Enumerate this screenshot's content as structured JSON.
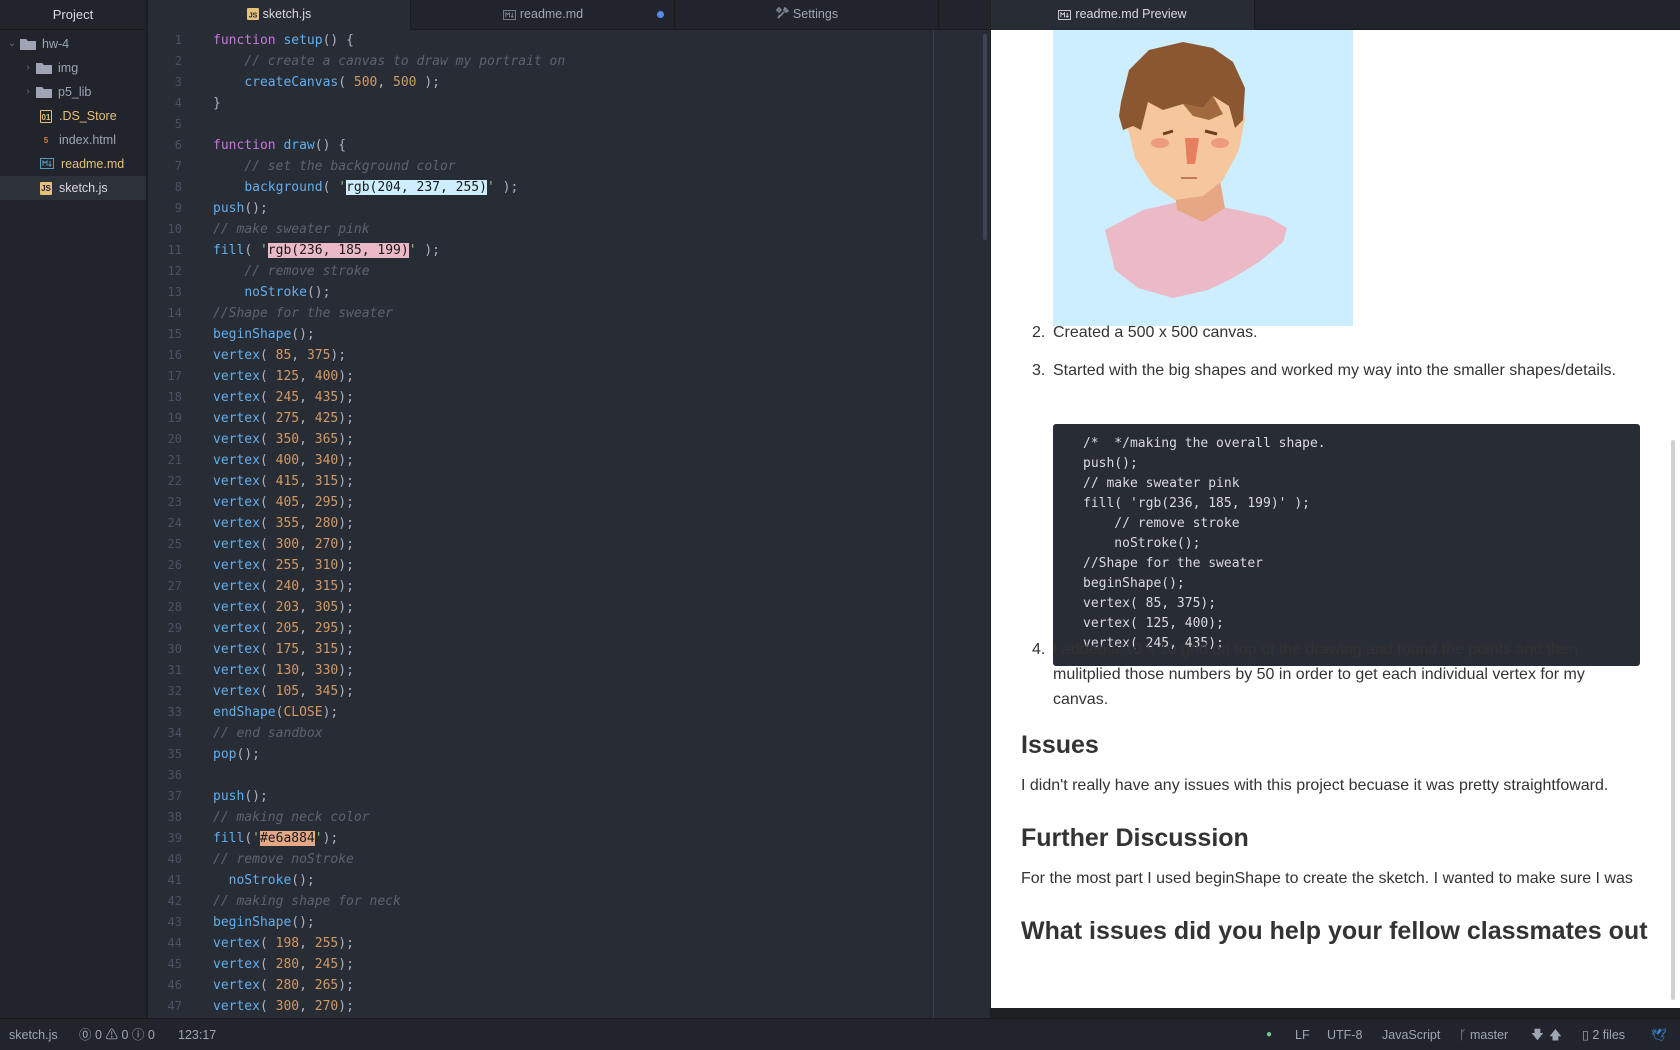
{
  "sidebar": {
    "title": "Project",
    "items": [
      {
        "label": "hw-4",
        "kind": "root"
      },
      {
        "label": "img",
        "kind": "folder"
      },
      {
        "label": "p5_lib",
        "kind": "folder"
      },
      {
        "label": ".DS_Store",
        "kind": "file",
        "icon": "binary-file-icon"
      },
      {
        "label": "index.html",
        "kind": "file",
        "icon": "html-file-icon"
      },
      {
        "label": "readme.md",
        "kind": "file",
        "icon": "markdown-file-icon"
      },
      {
        "label": "sketch.js",
        "kind": "file",
        "icon": "js-file-icon"
      }
    ]
  },
  "tabs": [
    {
      "label": "sketch.js",
      "active": true
    },
    {
      "label": "readme.md",
      "modified": true
    },
    {
      "label": "Settings"
    }
  ],
  "preview_tab": {
    "label": "readme.md Preview"
  },
  "editor": {
    "lines": [
      [
        [
          "kw",
          "function "
        ],
        [
          "fn",
          "setup"
        ],
        [
          "",
          "() {"
        ]
      ],
      [
        [
          "",
          "    "
        ],
        [
          "cm",
          "// create a canvas to draw my portrait on"
        ]
      ],
      [
        [
          "",
          "    "
        ],
        [
          "fn",
          "createCanvas"
        ],
        [
          "",
          "( "
        ],
        [
          "num",
          "500"
        ],
        [
          "",
          ", "
        ],
        [
          "num",
          "500"
        ],
        [
          "",
          " );"
        ]
      ],
      [
        [
          "",
          "}"
        ]
      ],
      [],
      [
        [
          "kw",
          "function "
        ],
        [
          "fn",
          "draw"
        ],
        [
          "",
          "() {"
        ]
      ],
      [
        [
          "",
          "    "
        ],
        [
          "cm",
          "// set the background color"
        ]
      ],
      [
        [
          "",
          "    "
        ],
        [
          "fn",
          "background"
        ],
        [
          "",
          "( "
        ],
        [
          "str",
          "'"
        ],
        [
          "sw-blue",
          "rgb(204, 237, 255)"
        ],
        [
          "str",
          "'"
        ],
        [
          "",
          " );"
        ]
      ],
      [
        [
          "fn",
          "push"
        ],
        [
          "",
          "();"
        ]
      ],
      [
        [
          "cm",
          "// make sweater pink"
        ]
      ],
      [
        [
          "fn",
          "fill"
        ],
        [
          "",
          "( "
        ],
        [
          "str",
          "'"
        ],
        [
          "sw-pink",
          "rgb(236, 185, 199)"
        ],
        [
          "str",
          "'"
        ],
        [
          "",
          " );"
        ]
      ],
      [
        [
          "",
          "    "
        ],
        [
          "cm",
          "// remove stroke"
        ]
      ],
      [
        [
          "",
          "    "
        ],
        [
          "fn",
          "noStroke"
        ],
        [
          "",
          "();"
        ]
      ],
      [
        [
          "cm",
          "//Shape for the sweater"
        ]
      ],
      [
        [
          "fn",
          "beginShape"
        ],
        [
          "",
          "();"
        ]
      ],
      [
        [
          "fn",
          "vertex"
        ],
        [
          "",
          "( "
        ],
        [
          "num",
          "85"
        ],
        [
          "",
          ", "
        ],
        [
          "num",
          "375"
        ],
        [
          "",
          ");"
        ]
      ],
      [
        [
          "fn",
          "vertex"
        ],
        [
          "",
          "( "
        ],
        [
          "num",
          "125"
        ],
        [
          "",
          ", "
        ],
        [
          "num",
          "400"
        ],
        [
          "",
          ");"
        ]
      ],
      [
        [
          "fn",
          "vertex"
        ],
        [
          "",
          "( "
        ],
        [
          "num",
          "245"
        ],
        [
          "",
          ", "
        ],
        [
          "num",
          "435"
        ],
        [
          "",
          ");"
        ]
      ],
      [
        [
          "fn",
          "vertex"
        ],
        [
          "",
          "( "
        ],
        [
          "num",
          "275"
        ],
        [
          "",
          ", "
        ],
        [
          "num",
          "425"
        ],
        [
          "",
          ");"
        ]
      ],
      [
        [
          "fn",
          "vertex"
        ],
        [
          "",
          "( "
        ],
        [
          "num",
          "350"
        ],
        [
          "",
          ", "
        ],
        [
          "num",
          "365"
        ],
        [
          "",
          ");"
        ]
      ],
      [
        [
          "fn",
          "vertex"
        ],
        [
          "",
          "( "
        ],
        [
          "num",
          "400"
        ],
        [
          "",
          ", "
        ],
        [
          "num",
          "340"
        ],
        [
          "",
          ");"
        ]
      ],
      [
        [
          "fn",
          "vertex"
        ],
        [
          "",
          "( "
        ],
        [
          "num",
          "415"
        ],
        [
          "",
          ", "
        ],
        [
          "num",
          "315"
        ],
        [
          "",
          ");"
        ]
      ],
      [
        [
          "fn",
          "vertex"
        ],
        [
          "",
          "( "
        ],
        [
          "num",
          "405"
        ],
        [
          "",
          ", "
        ],
        [
          "num",
          "295"
        ],
        [
          "",
          ");"
        ]
      ],
      [
        [
          "fn",
          "vertex"
        ],
        [
          "",
          "( "
        ],
        [
          "num",
          "355"
        ],
        [
          "",
          ", "
        ],
        [
          "num",
          "280"
        ],
        [
          "",
          ");"
        ]
      ],
      [
        [
          "fn",
          "vertex"
        ],
        [
          "",
          "( "
        ],
        [
          "num",
          "300"
        ],
        [
          "",
          ", "
        ],
        [
          "num",
          "270"
        ],
        [
          "",
          ");"
        ]
      ],
      [
        [
          "fn",
          "vertex"
        ],
        [
          "",
          "( "
        ],
        [
          "num",
          "255"
        ],
        [
          "",
          ", "
        ],
        [
          "num",
          "310"
        ],
        [
          "",
          ");"
        ]
      ],
      [
        [
          "fn",
          "vertex"
        ],
        [
          "",
          "( "
        ],
        [
          "num",
          "240"
        ],
        [
          "",
          ", "
        ],
        [
          "num",
          "315"
        ],
        [
          "",
          ");"
        ]
      ],
      [
        [
          "fn",
          "vertex"
        ],
        [
          "",
          "( "
        ],
        [
          "num",
          "203"
        ],
        [
          "",
          ", "
        ],
        [
          "num",
          "305"
        ],
        [
          "",
          ");"
        ]
      ],
      [
        [
          "fn",
          "vertex"
        ],
        [
          "",
          "( "
        ],
        [
          "num",
          "205"
        ],
        [
          "",
          ", "
        ],
        [
          "num",
          "295"
        ],
        [
          "",
          ");"
        ]
      ],
      [
        [
          "fn",
          "vertex"
        ],
        [
          "",
          "( "
        ],
        [
          "num",
          "175"
        ],
        [
          "",
          ", "
        ],
        [
          "num",
          "315"
        ],
        [
          "",
          ");"
        ]
      ],
      [
        [
          "fn",
          "vertex"
        ],
        [
          "",
          "( "
        ],
        [
          "num",
          "130"
        ],
        [
          "",
          ", "
        ],
        [
          "num",
          "330"
        ],
        [
          "",
          ");"
        ]
      ],
      [
        [
          "fn",
          "vertex"
        ],
        [
          "",
          "( "
        ],
        [
          "num",
          "105"
        ],
        [
          "",
          ", "
        ],
        [
          "num",
          "345"
        ],
        [
          "",
          ");"
        ]
      ],
      [
        [
          "fn",
          "endShape"
        ],
        [
          "",
          "("
        ],
        [
          "num",
          "CLOSE"
        ],
        [
          "",
          ");"
        ]
      ],
      [
        [
          "cm",
          "// end sandbox"
        ]
      ],
      [
        [
          "fn",
          "pop"
        ],
        [
          "",
          "();"
        ]
      ],
      [],
      [
        [
          "fn",
          "push"
        ],
        [
          "",
          "();"
        ]
      ],
      [
        [
          "cm",
          "// making neck color"
        ]
      ],
      [
        [
          "fn",
          "fill"
        ],
        [
          "",
          "("
        ],
        [
          "str",
          "'"
        ],
        [
          "sw-tan",
          "#e6a884"
        ],
        [
          "str",
          "'"
        ],
        [
          "",
          ");"
        ]
      ],
      [
        [
          "cm",
          "// remove noStroke"
        ]
      ],
      [
        [
          "",
          "  "
        ],
        [
          "fn",
          "noStroke"
        ],
        [
          "",
          "();"
        ]
      ],
      [
        [
          "cm",
          "// making shape for neck"
        ]
      ],
      [
        [
          "fn",
          "beginShape"
        ],
        [
          "",
          "();"
        ]
      ],
      [
        [
          "fn",
          "vertex"
        ],
        [
          "",
          "( "
        ],
        [
          "num",
          "198"
        ],
        [
          "",
          ", "
        ],
        [
          "num",
          "255"
        ],
        [
          "",
          ");"
        ]
      ],
      [
        [
          "fn",
          "vertex"
        ],
        [
          "",
          "( "
        ],
        [
          "num",
          "280"
        ],
        [
          "",
          ", "
        ],
        [
          "num",
          "245"
        ],
        [
          "",
          ");"
        ]
      ],
      [
        [
          "fn",
          "vertex"
        ],
        [
          "",
          "( "
        ],
        [
          "num",
          "280"
        ],
        [
          "",
          ", "
        ],
        [
          "num",
          "265"
        ],
        [
          "",
          ");"
        ]
      ],
      [
        [
          "fn",
          "vertex"
        ],
        [
          "",
          "( "
        ],
        [
          "num",
          "300"
        ],
        [
          "",
          ", "
        ],
        [
          "num",
          "270"
        ],
        [
          "",
          ");"
        ]
      ]
    ]
  },
  "preview": {
    "item2_num": "2.",
    "item2": "Created a 500 x 500 canvas.",
    "item3_num": "3.",
    "item3": "Started with the big shapes and worked my way into the smaller shapes/details.",
    "code_lines": [
      "/*  */making the overall shape.",
      "push();",
      "// make sweater pink",
      "fill( 'rgb(236, 185, 199)' );",
      "    // remove stroke",
      "    noStroke();",
      "//Shape for the sweater",
      "beginShape();",
      "vertex( 85, 375);",
      "vertex( 125, 400);",
      "vertex( 245, 435);"
    ],
    "item4_num": "4.",
    "item4_lines": [
      "I added a 10 x 10 grid on top of the drawing and found the points and then",
      "mulitplied those numbers by 50 in order to get each individual vertex for my",
      "canvas."
    ],
    "h_issues": "Issues",
    "p_issues": "I didn't really have any issues with this project becuase it was pretty straightfoward.",
    "h_further": "Further Discussion",
    "p_further": "For the most part I used beginShape to create the sketch. I wanted to make sure I was",
    "h_help": "What issues did you help your fellow classmates out"
  },
  "status": {
    "file": "sketch.js",
    "errors": "0",
    "warnings": "0",
    "infos": "0",
    "cursor": "123:17",
    "line_ending": "LF",
    "encoding": "UTF-8",
    "grammar": "JavaScript",
    "branch": "master",
    "files": "2 files"
  },
  "colors": {
    "bg_blue": "#cceeff",
    "sweater_pink": "#ecb9c7",
    "neck_tan": "#e6a884",
    "accent": "#568af2"
  }
}
